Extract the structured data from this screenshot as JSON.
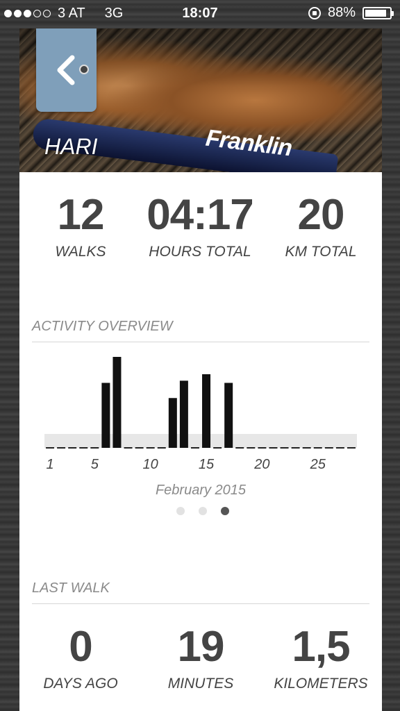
{
  "status_bar": {
    "carrier": "3 AT",
    "network": "3G",
    "time": "18:07",
    "battery": "88%",
    "battery_level": 0.88,
    "signal_bars_filled": 3,
    "signal_bars_total": 5
  },
  "profile": {
    "dog_name": "HARI",
    "bat_text": "Franklin"
  },
  "summary": {
    "walks": {
      "value": "12",
      "label": "WALKS"
    },
    "hours": {
      "value": "04:17",
      "label": "HOURS TOTAL"
    },
    "km": {
      "value": "20",
      "label": "KM TOTAL"
    }
  },
  "activity": {
    "title": "ACTIVITY OVERVIEW",
    "month": "February 2015",
    "pages": 3,
    "active_page": 3
  },
  "chart_data": {
    "type": "bar",
    "x": [
      1,
      2,
      3,
      4,
      5,
      6,
      7,
      8,
      9,
      10,
      11,
      12,
      13,
      14,
      15,
      16,
      17,
      18,
      19,
      20,
      21,
      22,
      23,
      24,
      25,
      26,
      27,
      28
    ],
    "values": [
      0,
      0,
      0,
      0,
      0,
      3.0,
      4.2,
      0,
      0,
      0,
      0,
      2.3,
      3.1,
      0,
      3.4,
      0,
      3.0,
      0,
      0,
      0,
      0,
      0,
      0,
      0,
      0,
      0,
      0,
      0
    ],
    "tick_labels": [
      "1",
      "5",
      "10",
      "15",
      "20",
      "25"
    ],
    "tick_values": [
      1,
      5,
      10,
      15,
      20,
      25
    ],
    "xlabel": "February 2015",
    "ylim": [
      0,
      4.2
    ]
  },
  "last_walk": {
    "title": "LAST WALK",
    "days": {
      "value": "0",
      "label": "DAYS AGO"
    },
    "minutes": {
      "value": "19",
      "label": "MINUTES"
    },
    "km": {
      "value": "1,5",
      "label": "KILOMETERS"
    }
  },
  "colors": {
    "accent": "#7f9fba",
    "bar": "#111111",
    "text": "#444444",
    "muted": "#8a8a8a"
  }
}
